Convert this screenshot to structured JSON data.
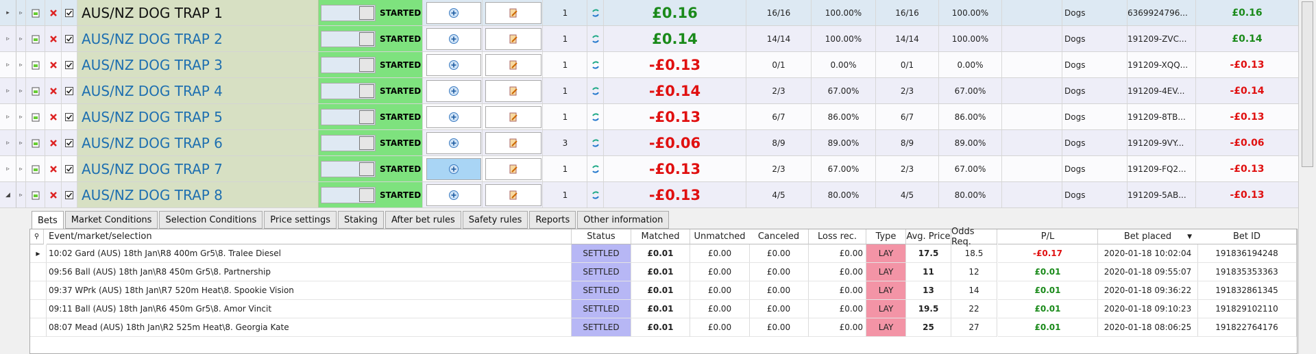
{
  "markets": [
    {
      "name": "AUS/NZ DOG TRAP 1",
      "status": "STARTED",
      "count": "1",
      "pl": "£0.16",
      "pl_sign": "pos",
      "matched_ratio": "16/16",
      "matched_pct": "100.00%",
      "won_ratio": "16/16",
      "won_pct": "100.00%",
      "empty": "",
      "sport": "Dogs",
      "market_id": "6369924796...",
      "pl_small": "£0.16"
    },
    {
      "name": "AUS/NZ DOG TRAP 2",
      "status": "STARTED",
      "count": "1",
      "pl": "£0.14",
      "pl_sign": "pos",
      "matched_ratio": "14/14",
      "matched_pct": "100.00%",
      "won_ratio": "14/14",
      "won_pct": "100.00%",
      "empty": "",
      "sport": "Dogs",
      "market_id": "191209-ZVC...",
      "pl_small": "£0.14"
    },
    {
      "name": "AUS/NZ DOG TRAP 3",
      "status": "STARTED",
      "count": "1",
      "pl": "-£0.13",
      "pl_sign": "neg",
      "matched_ratio": "0/1",
      "matched_pct": "0.00%",
      "won_ratio": "0/1",
      "won_pct": "0.00%",
      "empty": "",
      "sport": "Dogs",
      "market_id": "191209-XQQ...",
      "pl_small": "-£0.13"
    },
    {
      "name": "AUS/NZ DOG TRAP 4",
      "status": "STARTED",
      "count": "1",
      "pl": "-£0.14",
      "pl_sign": "neg",
      "matched_ratio": "2/3",
      "matched_pct": "67.00%",
      "won_ratio": "2/3",
      "won_pct": "67.00%",
      "empty": "",
      "sport": "Dogs",
      "market_id": "191209-4EV...",
      "pl_small": "-£0.14"
    },
    {
      "name": "AUS/NZ DOG TRAP 5",
      "status": "STARTED",
      "count": "1",
      "pl": "-£0.13",
      "pl_sign": "neg",
      "matched_ratio": "6/7",
      "matched_pct": "86.00%",
      "won_ratio": "6/7",
      "won_pct": "86.00%",
      "empty": "",
      "sport": "Dogs",
      "market_id": "191209-8TB...",
      "pl_small": "-£0.13"
    },
    {
      "name": "AUS/NZ DOG TRAP 6",
      "status": "STARTED",
      "count": "3",
      "pl": "-£0.06",
      "pl_sign": "neg",
      "matched_ratio": "8/9",
      "matched_pct": "89.00%",
      "won_ratio": "8/9",
      "won_pct": "89.00%",
      "empty": "",
      "sport": "Dogs",
      "market_id": "191209-9VY...",
      "pl_small": "-£0.06"
    },
    {
      "name": "AUS/NZ DOG TRAP 7",
      "status": "STARTED",
      "count": "1",
      "pl": "-£0.13",
      "pl_sign": "neg",
      "matched_ratio": "2/3",
      "matched_pct": "67.00%",
      "won_ratio": "2/3",
      "won_pct": "67.00%",
      "empty": "",
      "sport": "Dogs",
      "market_id": "191209-FQ2...",
      "pl_small": "-£0.13"
    },
    {
      "name": "AUS/NZ DOG TRAP 8",
      "status": "STARTED",
      "count": "1",
      "pl": "-£0.13",
      "pl_sign": "neg",
      "matched_ratio": "4/5",
      "matched_pct": "80.00%",
      "won_ratio": "4/5",
      "won_pct": "80.00%",
      "empty": "",
      "sport": "Dogs",
      "market_id": "191209-5AB...",
      "pl_small": "-£0.13"
    }
  ],
  "tabs": [
    "Bets",
    "Market Conditions",
    "Selection Conditions",
    "Price settings",
    "Staking",
    "After bet rules",
    "Safety rules",
    "Reports",
    "Other information"
  ],
  "bet_headers": [
    "Event/market/selection",
    "Status",
    "Matched",
    "Unmatched",
    "Canceled",
    "Loss rec.",
    "Type",
    "Avg. Price",
    "Odds Req.",
    "P/L",
    "Bet placed",
    "Bet ID"
  ],
  "bets": [
    {
      "event": "10:02 Gard (AUS) 18th Jan\\R8 400m Gr5\\8. Tralee Diesel",
      "status": "SETTLED",
      "matched": "£0.01",
      "unmatched": "£0.00",
      "canceled": "£0.00",
      "loss_rec": "£0.00",
      "type": "LAY",
      "avg_price": "17.5",
      "odds_req": "18.5",
      "pl": "-£0.17",
      "pl_sign": "neg",
      "placed": "2020-01-18 10:02:04",
      "bet_id": "191836194248"
    },
    {
      "event": "09:56 Ball (AUS) 18th Jan\\R8 450m Gr5\\8. Partnership",
      "status": "SETTLED",
      "matched": "£0.01",
      "unmatched": "£0.00",
      "canceled": "£0.00",
      "loss_rec": "£0.00",
      "type": "LAY",
      "avg_price": "11",
      "odds_req": "12",
      "pl": "£0.01",
      "pl_sign": "pos",
      "placed": "2020-01-18 09:55:07",
      "bet_id": "191835353363"
    },
    {
      "event": "09:37 WPrk (AUS) 18th Jan\\R7 520m Heat\\8. Spookie Vision",
      "status": "SETTLED",
      "matched": "£0.01",
      "unmatched": "£0.00",
      "canceled": "£0.00",
      "loss_rec": "£0.00",
      "type": "LAY",
      "avg_price": "13",
      "odds_req": "14",
      "pl": "£0.01",
      "pl_sign": "pos",
      "placed": "2020-01-18 09:36:22",
      "bet_id": "191832861345"
    },
    {
      "event": "09:11 Ball (AUS) 18th Jan\\R6 450m Gr5\\8. Amor Vincit",
      "status": "SETTLED",
      "matched": "£0.01",
      "unmatched": "£0.00",
      "canceled": "£0.00",
      "loss_rec": "£0.00",
      "type": "LAY",
      "avg_price": "19.5",
      "odds_req": "22",
      "pl": "£0.01",
      "pl_sign": "pos",
      "placed": "2020-01-18 09:10:23",
      "bet_id": "191829102110"
    },
    {
      "event": "08:07 Mead (AUS) 18th Jan\\R2 525m Heat\\8. Georgia Kate",
      "status": "SETTLED",
      "matched": "£0.01",
      "unmatched": "£0.00",
      "canceled": "£0.00",
      "loss_rec": "£0.00",
      "type": "LAY",
      "avg_price": "25",
      "odds_req": "27",
      "pl": "£0.01",
      "pl_sign": "pos",
      "placed": "2020-01-18 08:06:25",
      "bet_id": "191822764176"
    }
  ],
  "colors": {
    "positive": "#1a8a1a",
    "negative": "#e01010",
    "lay": "#f394a6",
    "settled": "#b7b7f5",
    "started": "#7ee27e"
  },
  "icons": {
    "expand": "triangle-right-icon",
    "add": "add-market-icon",
    "delete": "delete-icon",
    "check": "checkbox-icon",
    "plus": "plus-circle-icon",
    "edit": "edit-icon",
    "refresh": "refresh-icon",
    "sort": "sort-down-icon",
    "search": "search-icon"
  }
}
